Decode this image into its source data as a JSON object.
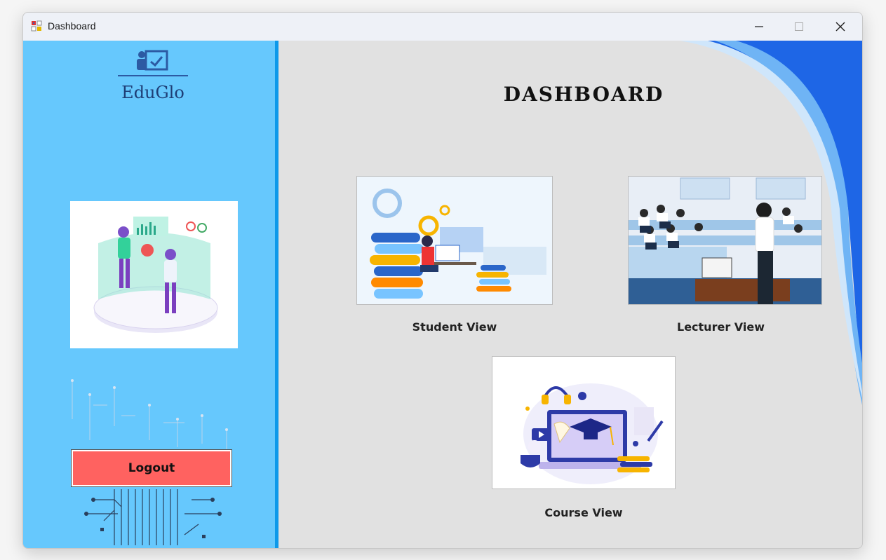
{
  "window": {
    "title": "Dashboard"
  },
  "titlebar": {
    "minimize_icon": "minimize-icon",
    "maximize_icon": "maximize-icon",
    "close_icon": "close-icon"
  },
  "sidebar": {
    "logo_text": "EduGlo",
    "logout_label": "Logout",
    "accent": "#66c8fd",
    "border": "#0d99ea"
  },
  "main": {
    "heading": "DASHBOARD",
    "cards": [
      {
        "label": "Student View"
      },
      {
        "label": "Lecturer View"
      },
      {
        "label": "Course View"
      }
    ]
  },
  "colors": {
    "logout": "#ff6260",
    "background": "#e1e1e1",
    "swirl": "#1e66e6"
  }
}
